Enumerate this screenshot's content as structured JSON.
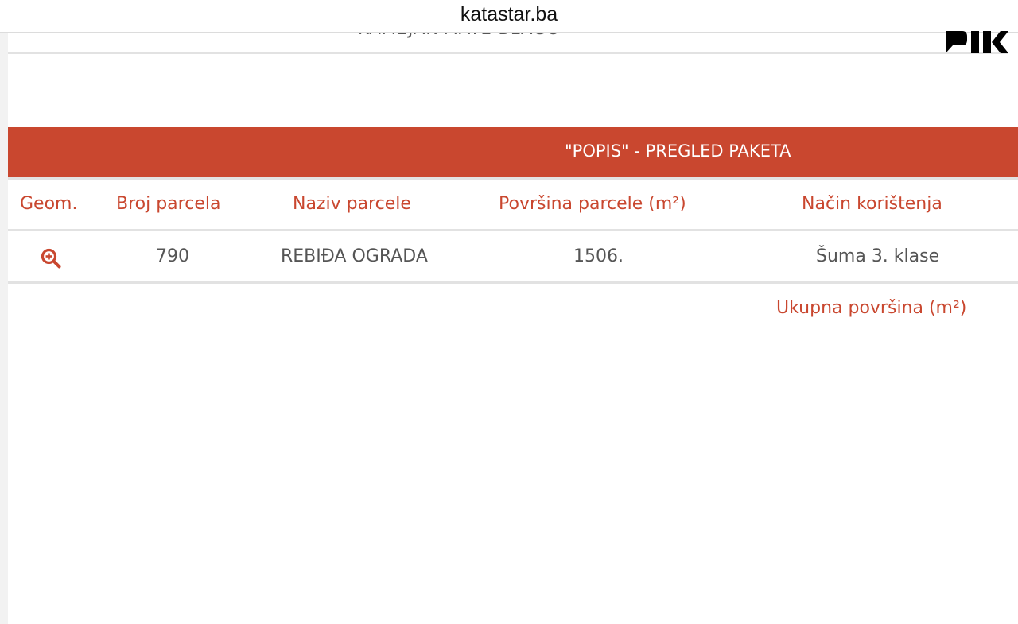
{
  "browser": {
    "url": "katastar.ba"
  },
  "page": {
    "owner_name_partial": "KAMEJAK MATE BLAGO",
    "panel_title": "\"POPIS\" - PREGLED PAKETA"
  },
  "table": {
    "headers": {
      "geom": "Geom.",
      "parcel_number": "Broj parcela",
      "parcel_name": "Naziv parcele",
      "parcel_area": "Površina parcele (m²)",
      "usage": "Način korištenja"
    },
    "rows": [
      {
        "geom_icon": "zoom-in-icon",
        "parcel_number": "790",
        "parcel_name": "REBIĐA OGRADA",
        "parcel_area": "1506.",
        "usage": "Šuma 3. klase"
      }
    ],
    "total_label": "Ukupna površina (m²)"
  },
  "colors": {
    "accent": "#c9472f",
    "text_muted": "#555555",
    "rule": "#e2e2e2"
  },
  "logo": {
    "icon": "pik-logo-icon",
    "text": "PIK"
  }
}
